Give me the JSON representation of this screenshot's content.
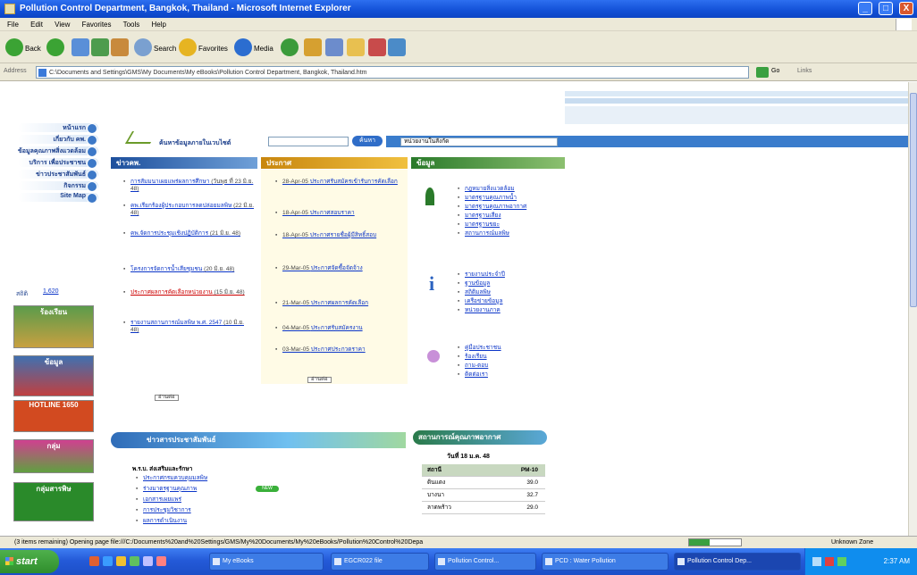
{
  "window": {
    "title": "Pollution Control Department, Bangkok, Thailand - Microsoft Internet Explorer",
    "minimize": "_",
    "maximize": "□",
    "close": "X"
  },
  "menu": [
    "File",
    "Edit",
    "View",
    "Favorites",
    "Tools",
    "Help"
  ],
  "toolbar": {
    "back": "Back",
    "search": "Search",
    "favorites": "Favorites",
    "media": "Media"
  },
  "address": {
    "label": "Address",
    "value": "C:\\Documents and Settings\\GMS\\My Documents\\My eBooks\\Pollution Control Department, Bangkok, Thailand.htm",
    "go": "Go",
    "links": "Links"
  },
  "page": {
    "nav": [
      "หน้าแรก",
      "เกี่ยวกับ คพ.",
      "ข้อมูลคุณภาพสิ่งแวดล้อม",
      "บริการ เพื่อประชาชน",
      "ข่าวประชาสัมพันธ์",
      "กิจกรรม",
      "Site Map"
    ],
    "nav_footer": "สถิติ",
    "search_label": "ค้นหาข้อมูลภายในเวบไซต์",
    "search_button": "ค้นหา",
    "search_select": "หน่วยงานในสังกัด",
    "col1_header": "ข่าวคพ.",
    "col2_header": "ประกาศ",
    "col3_header": "ข้อมูล",
    "col1_items": [
      {
        "text": "การสัมมนาเผยแพร่ผลการศึกษา",
        "sub": "(วันพุธ ที่ 23 มิ.ย. 48)"
      },
      {
        "text": "คพ.เรียกร้องผู้ประกอบการลดปล่อยมลพิษ",
        "sub": "(22 มิ.ย. 48)"
      },
      {
        "text": "คพ.จัดการประชุมเชิงปฏิบัติการ",
        "sub": "(21 มิ.ย. 48)"
      },
      {
        "text": "โครงการจัดการน้ำเสียชุมชน",
        "sub": "(20 มิ.ย. 48)"
      },
      {
        "text": "ประกาศผลการคัดเลือกหน่วยงาน",
        "sub": "(15 มิ.ย. 48)",
        "red": true
      },
      {
        "text": "รายงานสถานการณ์มลพิษ พ.ศ. 2547",
        "sub": "(10 มิ.ย. 48)"
      }
    ],
    "col2_items": [
      {
        "date": "28-Apr-05",
        "text": "ประกาศรับสมัครเข้ารับการคัดเลือก"
      },
      {
        "date": "18-Apr-05",
        "text": "ประกาศสอบราคา"
      },
      {
        "date": "18-Apr-05",
        "text": "ประกาศรายชื่อผู้มีสิทธิ์สอบ"
      },
      {
        "date": "29-Mar-05",
        "text": "ประกาศจัดซื้อจัดจ้าง"
      },
      {
        "date": "21-Mar-05",
        "text": "ประกาศผลการคัดเลือก"
      },
      {
        "date": "04-Mar-05",
        "text": "ประกาศรับสมัครงาน"
      },
      {
        "date": "03-Mar-05",
        "text": "ประกาศประกวดราคา"
      }
    ],
    "col3_group1": [
      "กฎหมายสิ่งแวดล้อม",
      "มาตรฐานคุณภาพน้ำ",
      "มาตรฐานคุณภาพอากาศ",
      "มาตรฐานเสียง",
      "มาตรฐานขยะ",
      "สถานการณ์มลพิษ"
    ],
    "col3_group2": [
      "รายงานประจำปี",
      "ฐานข้อมูล",
      "สถิติมลพิษ",
      "เครือข่ายข้อมูล",
      "หน่วยงานภาค"
    ],
    "col3_group3": [
      "คู่มือประชาชน",
      "ร้องเรียน",
      "ถาม-ตอบ",
      "ติดต่อเรา"
    ],
    "more": "อ่านต่อ",
    "bottom_header": "ข่าวสารประชาสัมพันธ์",
    "bottom_items": [
      "ประกาศกรมควบคุมมลพิษ",
      "ร่างมาตรฐานคุณภาพ",
      "เอกสารเผยแพร่",
      "การประชุมวิชาการ",
      "ผลการดำเนินงาน"
    ],
    "bottom_first": "พ.ร.บ. ส่งเสริมและรักษา",
    "aqi_header": "สถานการณ์คุณภาพอากาศ",
    "aqi_date": "วันที่ 18 ม.ค. 48",
    "aqi_cols": [
      "สถานี",
      "PM-10"
    ],
    "aqi_rows": [
      [
        "ดินแดง",
        "39.0"
      ],
      [
        "บางนา",
        "32.7"
      ],
      [
        "ลาดพร้าว",
        "29.0"
      ]
    ],
    "banners": [
      "ร้องเรียน",
      "ข้อมูล",
      "HOTLINE 1650",
      "กลุ่ม",
      "กลุ่มสารพิษ"
    ]
  },
  "status": {
    "text": "(3 items remaining) Opening page file:///C:/Documents%20and%20Settings/GMS/My%20Documents/My%20eBooks/Pollution%20Control%20Depa",
    "zone": "Unknown Zone",
    "progress": 0.4
  },
  "taskbar": {
    "start": "start",
    "tasks": [
      "My eBooks",
      "EGCR022 file",
      "Pollution Control...",
      "PCD : Water Pollution",
      "Pollution Control Dep..."
    ],
    "clock": "2:37 AM"
  }
}
